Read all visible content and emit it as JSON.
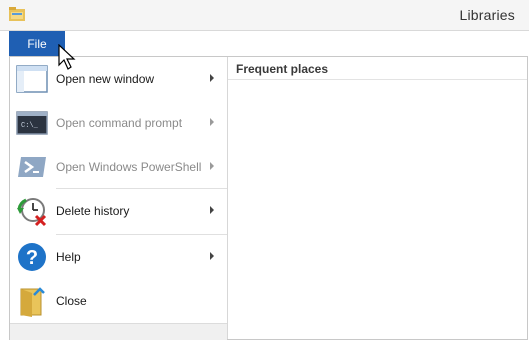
{
  "window": {
    "title": "Libraries",
    "icon": "folder-icon"
  },
  "menubar": {
    "file_label": "File"
  },
  "menu": {
    "items": [
      {
        "label": "Open new window",
        "icon": "window-icon",
        "enabled": true,
        "has_submenu": true
      },
      {
        "label": "Open command prompt",
        "icon": "command-prompt-icon",
        "enabled": false,
        "has_submenu": true
      },
      {
        "label": "Open Windows PowerShell",
        "icon": "powershell-icon",
        "enabled": false,
        "has_submenu": true
      },
      {
        "label": "Delete history",
        "icon": "delete-history-icon",
        "enabled": true,
        "has_submenu": true
      },
      {
        "label": "Help",
        "icon": "help-icon",
        "enabled": true,
        "has_submenu": true
      },
      {
        "label": "Close",
        "icon": "close-folder-icon",
        "enabled": true,
        "has_submenu": false
      }
    ]
  },
  "frequent_places": {
    "header": "Frequent places"
  },
  "colors": {
    "accent": "#1f5fb3",
    "disabled_text": "#8a8a8a"
  }
}
